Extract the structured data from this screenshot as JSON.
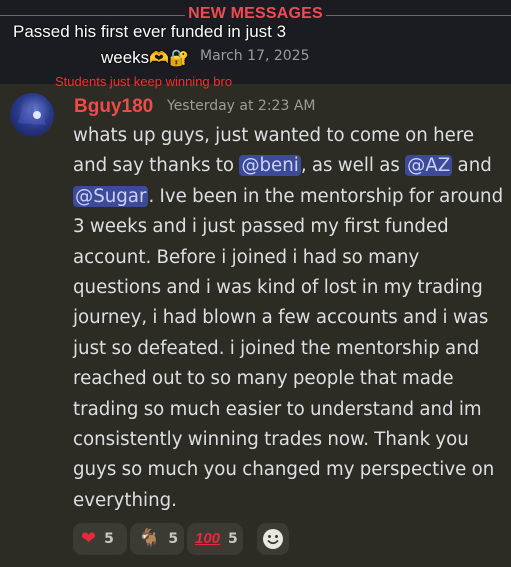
{
  "divider": {
    "label": "NEW MESSAGES"
  },
  "caption": {
    "line1": "Passed his first ever funded in just 3",
    "line2": "weeks",
    "line2_emojis": "🫶🔐",
    "sub": "Students just keep winning bro"
  },
  "date": "March 17, 2025",
  "message": {
    "author": "Bguy180",
    "timestamp": "Yesterday at 2:23 AM",
    "body_parts": {
      "p1": "whats up guys, just wanted to come on here and say thanks to ",
      "m1": "@beni",
      "p2": ", as well as ",
      "m2": "@AZ",
      "p3": " and ",
      "m3": "@Sugar",
      "p4": ". Ive been in the mentorship for around 3 weeks and i just passed my first funded account. Before i joined i had so many questions and i was kind of lost in my trading journey, i had blown a few accounts and i was just so defeated. i joined the mentorship and reached out to so many people that made trading so much easier to understand and im consistently winning trades now. Thank you guys so much you changed my perspective on everything."
    }
  },
  "reactions": [
    {
      "icon": "heart-icon",
      "emoji": "❤",
      "count": "5"
    },
    {
      "icon": "goat-icon",
      "emoji": "🐐",
      "count": "5"
    },
    {
      "icon": "hundred-points-icon",
      "emoji": "100",
      "count": "5"
    }
  ],
  "add_reaction": {
    "icon": "add-reaction-smiley-icon"
  },
  "colors": {
    "new_messages": "#f04a55",
    "author": "#ee4b4b",
    "mention_bg": "#3d4a99",
    "message_bg": "#2c2c24",
    "sub_caption": "#ff2a2a"
  }
}
